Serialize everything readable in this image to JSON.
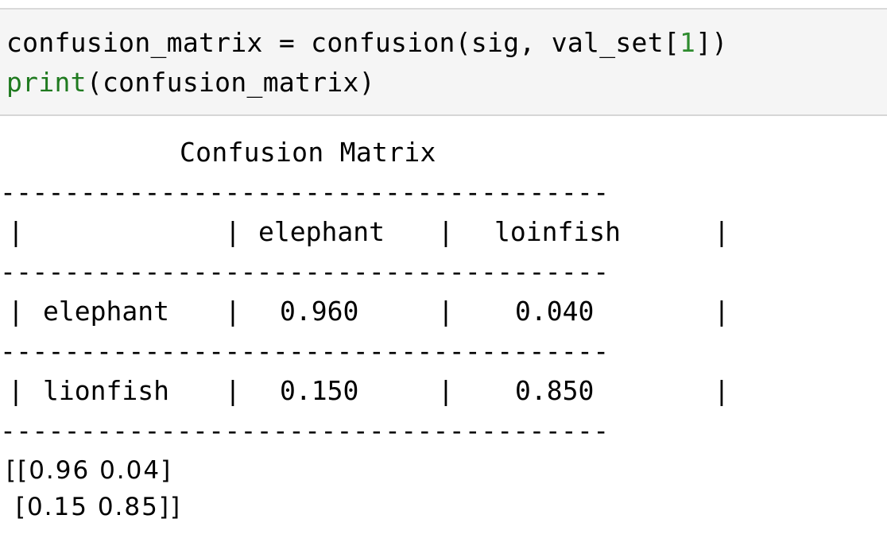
{
  "code": {
    "line1_text": "confusion_matrix = confusion(sig, val_set[",
    "line1_num": "1",
    "line1_end": "])",
    "line2_func": "print",
    "line2_rest": "(confusion_matrix)"
  },
  "output": {
    "title": "Confusion Matrix",
    "separator": "--------------------------------------",
    "header": {
      "col1": "elephant",
      "col2": "loinfish"
    },
    "rows": [
      {
        "label": "elephant",
        "v1": "0.960",
        "v2": "0.040"
      },
      {
        "label": "lionfish",
        "v1": "0.150",
        "v2": "0.850"
      }
    ],
    "array_line1": "[[0.96 0.04]",
    "array_line2": " [0.15 0.85]]"
  }
}
